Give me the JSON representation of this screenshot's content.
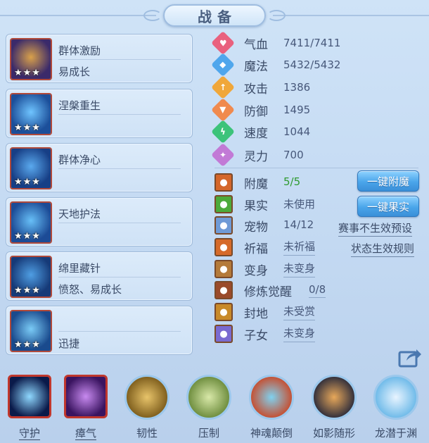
{
  "title": "战备",
  "skills": [
    {
      "name": "群体激励",
      "desc": "易成长",
      "stars": "★★★",
      "colors": [
        "#3b2a6a",
        "#d9a14a"
      ]
    },
    {
      "name": "涅槃重生",
      "desc": "",
      "stars": "★★★",
      "colors": [
        "#1c4f9a",
        "#6fc4ff"
      ]
    },
    {
      "name": "群体净心",
      "desc": "",
      "stars": "★★★",
      "colors": [
        "#173f86",
        "#5aa9ee"
      ]
    },
    {
      "name": "天地护法",
      "desc": "",
      "stars": "★★★",
      "colors": [
        "#1c4b96",
        "#67bff7"
      ]
    },
    {
      "name": "绵里藏针",
      "desc": "愤怒、易成长",
      "stars": "★★★",
      "colors": [
        "#163a78",
        "#4f9ee3"
      ]
    },
    {
      "name": "",
      "desc": "迅捷",
      "stars": "★★★",
      "colors": [
        "#1a4a8d",
        "#7acbf6"
      ]
    }
  ],
  "stats": [
    {
      "label": "气血",
      "value": "7411/7411",
      "icon": "heart-icon",
      "color": "#e9617e",
      "glyph": "♥"
    },
    {
      "label": "魔法",
      "value": "5432/5432",
      "icon": "shield-icon",
      "color": "#4fa6ec",
      "glyph": "◆"
    },
    {
      "label": "攻击",
      "value": "1386",
      "icon": "sword-icon",
      "color": "#f0a73a",
      "glyph": "↑"
    },
    {
      "label": "防御",
      "value": "1495",
      "icon": "armor-icon",
      "color": "#f08a4e",
      "glyph": "▼"
    },
    {
      "label": "速度",
      "value": "1044",
      "icon": "lightning-icon",
      "color": "#3cc37a",
      "glyph": "ϟ"
    },
    {
      "label": "灵力",
      "value": "700",
      "icon": "spirit-icon",
      "color": "#c27ad6",
      "glyph": "✦"
    }
  ],
  "equip": [
    {
      "label": "附魔",
      "value": "5/5",
      "icon": "enchant-icon",
      "color": "#d4662a",
      "green": true,
      "underline": false
    },
    {
      "label": "果实",
      "value": "未使用",
      "icon": "fruit-icon",
      "color": "#4caa3a",
      "green": false,
      "underline": false
    },
    {
      "label": "宠物",
      "value": "14/12",
      "icon": "pet-icon",
      "color": "#6f9ad6",
      "green": false,
      "underline": false
    },
    {
      "label": "祈福",
      "value": "未祈福",
      "icon": "blessing-icon",
      "color": "#d66a2a",
      "green": false,
      "underline": true
    },
    {
      "label": "变身",
      "value": "未变身",
      "icon": "transform-icon",
      "color": "#b47a3a",
      "green": false,
      "underline": true
    },
    {
      "label": "修炼觉醒",
      "value": "0/8",
      "icon": "cultivation-icon",
      "color": "#9a4a2a",
      "green": false,
      "underline": true
    },
    {
      "label": "封地",
      "value": "未受赏",
      "icon": "fief-icon",
      "color": "#c88a2a",
      "green": false,
      "underline": true
    },
    {
      "label": "子女",
      "value": "未变身",
      "icon": "children-icon",
      "color": "#7a6ad0",
      "green": false,
      "underline": true
    }
  ],
  "buttons": {
    "enchant": "一键附魔",
    "fruit": "一键果实"
  },
  "links": {
    "preset": "赛事不生效预设",
    "rules": "状态生效规则"
  },
  "bottom_skills": [
    {
      "label": "守护",
      "frame": "square",
      "underline": true,
      "colors": [
        "#0a1a4a",
        "#8fd8ff"
      ]
    },
    {
      "label": "瘴气",
      "frame": "square",
      "underline": true,
      "colors": [
        "#3a1460",
        "#c88af0"
      ]
    },
    {
      "label": "韧性",
      "frame": "round",
      "underline": false,
      "colors": [
        "#7a5a1a",
        "#e8c46a"
      ]
    },
    {
      "label": "压制",
      "frame": "round",
      "underline": false,
      "colors": [
        "#6a8a3a",
        "#d8e8a8"
      ]
    },
    {
      "label": "神魂颠倒",
      "frame": "round",
      "underline": false,
      "colors": [
        "#c84a2a",
        "#7fd2f0"
      ]
    },
    {
      "label": "如影随形",
      "frame": "round",
      "underline": false,
      "colors": [
        "#2a2a3a",
        "#e8a85a"
      ]
    },
    {
      "label": "龙潜于渊",
      "frame": "round",
      "underline": false,
      "colors": [
        "#6ab8e8",
        "#e8f4ff"
      ]
    }
  ]
}
